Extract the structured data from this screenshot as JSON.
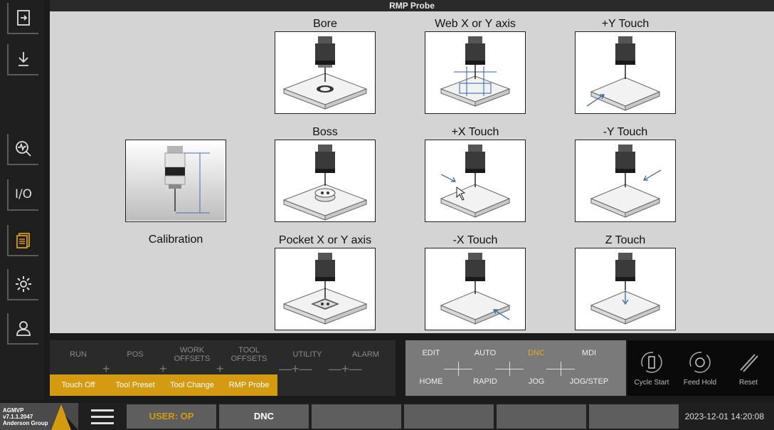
{
  "title": "RMP Probe",
  "calibration": {
    "label": "Calibration"
  },
  "tiles": [
    {
      "label": "Bore"
    },
    {
      "label": "Web X or Y axis"
    },
    {
      "label": "+Y Touch"
    },
    {
      "label": "Boss"
    },
    {
      "label": "+X Touch"
    },
    {
      "label": "-Y Touch"
    },
    {
      "label": "Pocket X or Y axis"
    },
    {
      "label": "-X Touch"
    },
    {
      "label": "Z Touch"
    }
  ],
  "sidebar": {
    "icons": [
      "exit-icon",
      "download-icon",
      "diagnostics-icon",
      "io-icon",
      "document-icon",
      "settings-icon",
      "user-icon"
    ],
    "io_label": "I/O"
  },
  "modes": {
    "top": [
      "RUN",
      "POS",
      "WORK\nOFFSETS",
      "TOOL\nOFFSETS",
      "UTILITY",
      "ALARM"
    ],
    "bottom": [
      "Touch Off",
      "Tool Preset",
      "Tool Change",
      "RMP Probe"
    ]
  },
  "dnc": {
    "top": [
      "EDIT",
      "AUTO",
      "DNC",
      "MDI"
    ],
    "bottom": [
      "HOME",
      "RAPID",
      "JOG",
      "JOG/STEP"
    ],
    "active": "DNC",
    "active_color": "#e8a820"
  },
  "cycle": [
    "Cycle Start",
    "Feed Hold",
    "Reset"
  ],
  "status": {
    "logo_lines": [
      "AGMVP",
      "v7.1.1.2047",
      "Anderson Group"
    ],
    "user": "USER: OP",
    "mode": "DNC",
    "clock": "2023-12-01 14:20:08"
  },
  "colors": {
    "accent": "#d49a12",
    "panel": "#d4d4d4",
    "dark": "#1b1b1b"
  }
}
